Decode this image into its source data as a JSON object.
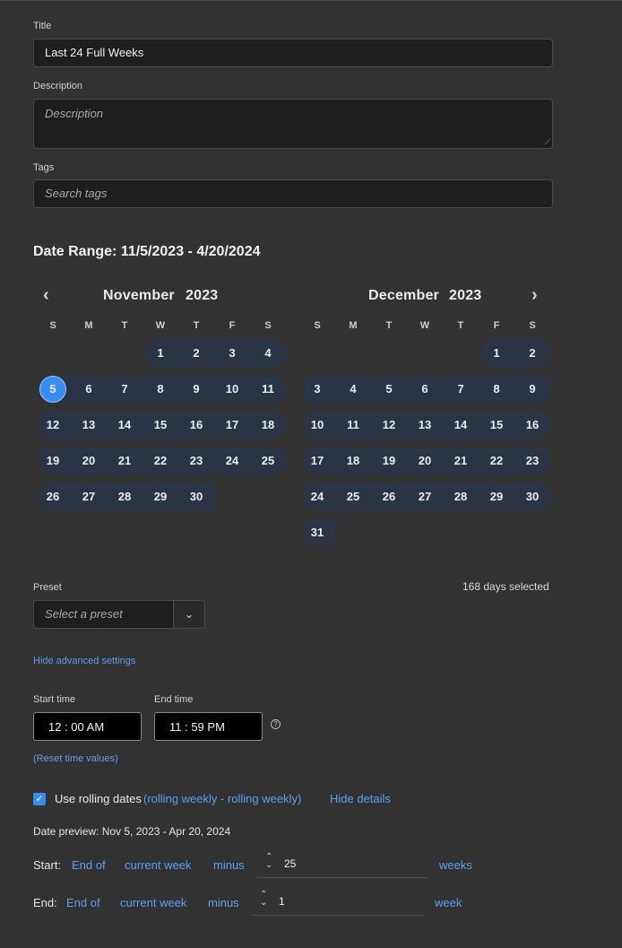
{
  "form": {
    "title_label": "Title",
    "title_value": "Last 24 Full Weeks",
    "description_label": "Description",
    "description_placeholder": "Description",
    "tags_label": "Tags",
    "tags_placeholder": "Search tags"
  },
  "date_range": {
    "heading": "Date Range: 11/5/2023 - 4/20/2024"
  },
  "calendar_left": {
    "month": "November",
    "year": "2023",
    "dow": [
      "S",
      "M",
      "T",
      "W",
      "T",
      "F",
      "S"
    ],
    "weeks": [
      [
        "",
        "",
        "",
        "1",
        "2",
        "3",
        "4"
      ],
      [
        "5",
        "6",
        "7",
        "8",
        "9",
        "10",
        "11"
      ],
      [
        "12",
        "13",
        "14",
        "15",
        "16",
        "17",
        "18"
      ],
      [
        "19",
        "20",
        "21",
        "22",
        "23",
        "24",
        "25"
      ],
      [
        "26",
        "27",
        "28",
        "29",
        "30",
        "",
        ""
      ]
    ],
    "range_start_day": "5"
  },
  "calendar_right": {
    "month": "December",
    "year": "2023",
    "dow": [
      "S",
      "M",
      "T",
      "W",
      "T",
      "F",
      "S"
    ],
    "weeks": [
      [
        "",
        "",
        "",
        "",
        "",
        "1",
        "2"
      ],
      [
        "3",
        "4",
        "5",
        "6",
        "7",
        "8",
        "9"
      ],
      [
        "10",
        "11",
        "12",
        "13",
        "14",
        "15",
        "16"
      ],
      [
        "17",
        "18",
        "19",
        "20",
        "21",
        "22",
        "23"
      ],
      [
        "24",
        "25",
        "26",
        "27",
        "28",
        "29",
        "30"
      ],
      [
        "31",
        "",
        "",
        "",
        "",
        "",
        ""
      ]
    ]
  },
  "preset": {
    "label": "Preset",
    "placeholder": "Select a preset",
    "days_selected": "168 days selected"
  },
  "advanced": {
    "toggle_label": "Hide advanced settings",
    "start_time_label": "Start time",
    "start_time_value": "12 : 00  AM",
    "end_time_label": "End time",
    "end_time_value": "11 : 59  PM",
    "reset_label": "(Reset time values)"
  },
  "rolling": {
    "checkbox_label": "Use rolling dates",
    "checked": true,
    "summary_link": "(rolling weekly - rolling weekly)",
    "hide_details": "Hide details",
    "preview": "Date preview: Nov 5, 2023 - Apr 20, 2024",
    "start": {
      "label": "Start:",
      "anchor": "End of",
      "period": "current week",
      "op": "minus",
      "amount": "25",
      "unit": "weeks"
    },
    "end": {
      "label": "End:",
      "anchor": "End of",
      "period": "current week",
      "op": "minus",
      "amount": "1",
      "unit": "week"
    }
  },
  "colors": {
    "background": "#323232",
    "range_fill": "#2a3447",
    "accent": "#378ef0",
    "link": "#5b9ef0"
  }
}
